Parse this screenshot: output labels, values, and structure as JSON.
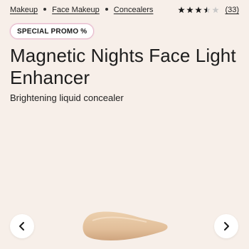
{
  "breadcrumb": {
    "items": [
      "Makeup",
      "Face Makeup",
      "Concealers"
    ]
  },
  "rating": {
    "value": 3.5,
    "max": 5,
    "count_label": "(33)",
    "star_color": "#1a1a1a",
    "empty_star_color": "#c8c8c8"
  },
  "promo": {
    "label": "SPECIAL PROMO %"
  },
  "product": {
    "title": "Magnetic Nights Face Light Enhancer",
    "subtitle": "Brightening liquid concealer"
  },
  "gallery": {
    "prev_icon": "chevron-left-icon",
    "next_icon": "chevron-right-icon",
    "swatch_color": "#e2bf9a"
  },
  "colors": {
    "background": "#f7efe9",
    "promo_border": "#e6b9c8"
  }
}
